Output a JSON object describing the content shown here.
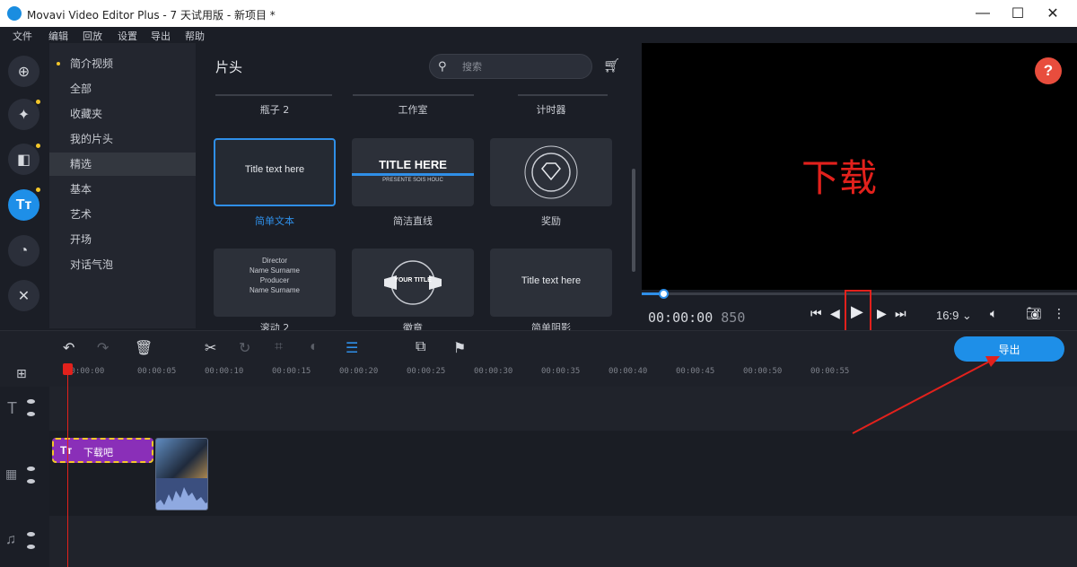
{
  "window": {
    "title": "Movavi Video Editor Plus - 7 天试用版 - 新项目 *",
    "minimize": "—",
    "maximize": "☐",
    "close": "✕"
  },
  "menu": [
    "文件",
    "编辑",
    "回放",
    "设置",
    "导出",
    "帮助"
  ],
  "rail": [
    "import-icon",
    "magic-wand-icon",
    "transitions-icon",
    "titles-icon",
    "clock-icon",
    "tools-icon"
  ],
  "categories": [
    {
      "label": "简介视频",
      "dot": true
    },
    {
      "label": "全部",
      "dot": false
    },
    {
      "label": "收藏夹",
      "dot": false
    },
    {
      "label": "我的片头",
      "dot": false
    },
    {
      "label": "精选",
      "dot": false,
      "active": true
    },
    {
      "label": "基本",
      "dot": false
    },
    {
      "label": "艺术",
      "dot": false
    },
    {
      "label": "开场",
      "dot": false
    },
    {
      "label": "对话气泡",
      "dot": false
    }
  ],
  "panel": {
    "title": "片头",
    "search_placeholder": "搜索",
    "top_row_labels": [
      "瓶子 2",
      "工作室",
      "计时器"
    ],
    "tiles": [
      {
        "label": "简单文本",
        "preview_text": "Title text here",
        "selected": true
      },
      {
        "label": "简洁直线",
        "preview_text": "TITLE HERE",
        "preview_sub": "PRESENTE SOIS HOUC"
      },
      {
        "label": "奖励",
        "preview_text": ""
      },
      {
        "label": "滚动 2",
        "preview_text": "Director\nName Surname\nProducer\nName Surname"
      },
      {
        "label": "徽章",
        "preview_text": "YOUR TITLE"
      },
      {
        "label": "简单阴影",
        "preview_text": "Title text here"
      }
    ]
  },
  "preview": {
    "overlay_text": "下载",
    "help": "?"
  },
  "controls": {
    "time": "00:00:00",
    "frames": "850",
    "aspect": "16:9 ⌄",
    "progress": 0.1
  },
  "toolbar": {
    "export_label": "导出"
  },
  "ruler": {
    "labels": [
      "00:00:00",
      "00:00:05",
      "00:00:10",
      "00:00:15",
      "00:00:20",
      "00:00:25",
      "00:00:30",
      "00:00:35",
      "00:00:40",
      "00:00:45",
      "00:00:50",
      "00:00:55"
    ]
  },
  "clips": {
    "title_clip_label": "下载吧"
  },
  "colors": {
    "accent": "#1e8fe8",
    "annotation_red": "#e2211c",
    "title_clip": "#8a2fb8",
    "highlight_yellow": "#f3c62a"
  }
}
